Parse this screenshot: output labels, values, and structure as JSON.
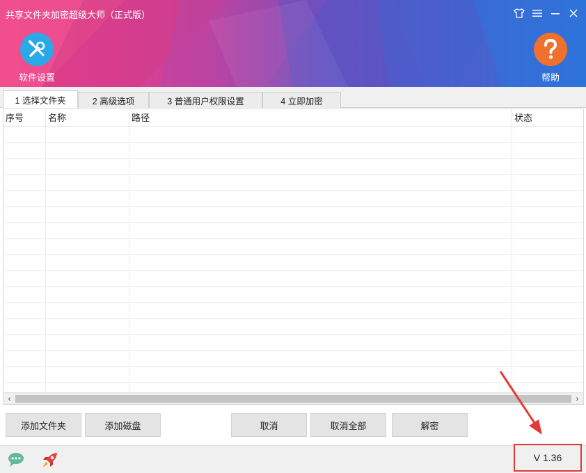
{
  "window": {
    "title": "共享文件夹加密超级大师（正式版）"
  },
  "toolbar": {
    "settings_label": "软件设置",
    "help_label": "帮助"
  },
  "tabs": [
    {
      "label": "1 选择文件夹",
      "active": true
    },
    {
      "label": "2 高级选项",
      "active": false
    },
    {
      "label": "3 普通用户权限设置",
      "active": false
    },
    {
      "label": "4 立即加密",
      "active": false
    }
  ],
  "table": {
    "columns": [
      "序号",
      "名称",
      "路径",
      "状态"
    ],
    "rows": []
  },
  "buttons": {
    "add_folder": "添加文件夹",
    "add_disk": "添加磁盘",
    "cancel": "取消",
    "cancel_all": "取消全部",
    "decrypt": "解密"
  },
  "status": {
    "version": "V 1.36"
  },
  "colors": {
    "header_gradient_start": "#ef3f8a",
    "header_gradient_end": "#2f6fd6",
    "settings_icon_bg": "#2aa8e8",
    "help_icon_bg": "#f0702e",
    "highlight_red": "#e53935"
  },
  "icons": [
    "shirt-icon",
    "menu-icon",
    "minimize-icon",
    "close-icon",
    "tools-icon",
    "help-icon",
    "chat-icon",
    "rocket-icon"
  ]
}
